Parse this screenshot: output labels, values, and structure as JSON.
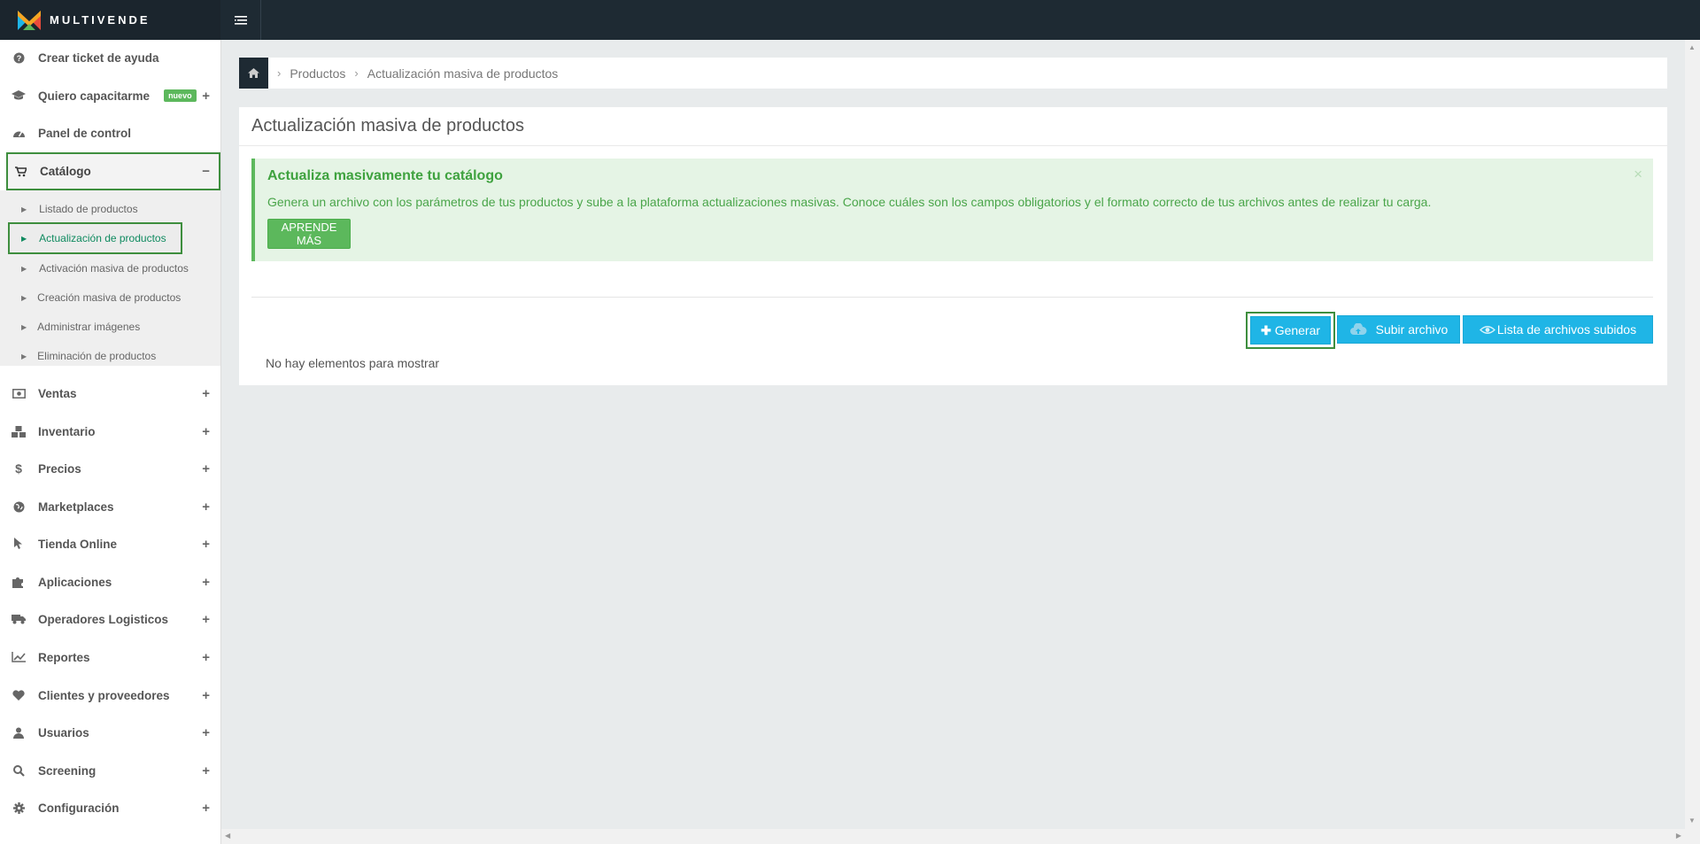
{
  "brand": {
    "name": "MULTIVENDE",
    "colors": {
      "topbar": "#1e2a33",
      "accent": "#5cb85c",
      "primary_button": "#1fb5e6"
    }
  },
  "sidebar": {
    "items": [
      {
        "label": "Crear ticket de ayuda",
        "icon": "question-circle-icon"
      },
      {
        "label": "Quiero capacitarme",
        "icon": "graduation-cap-icon",
        "badge": "nuevo",
        "expand": "+"
      },
      {
        "label": "Panel de control",
        "icon": "dashboard-icon"
      },
      {
        "label": "Catálogo",
        "icon": "shopping-cart-icon",
        "expand": "−"
      },
      {
        "label": "Ventas",
        "icon": "money-icon",
        "expand": "+"
      },
      {
        "label": "Inventario",
        "icon": "cubes-icon",
        "expand": "+"
      },
      {
        "label": "Precios",
        "icon": "dollar-icon",
        "expand": "+"
      },
      {
        "label": "Marketplaces",
        "icon": "globe-icon",
        "expand": "+"
      },
      {
        "label": "Tienda Online",
        "icon": "pointer-icon",
        "expand": "+"
      },
      {
        "label": "Aplicaciones",
        "icon": "puzzle-icon",
        "expand": "+"
      },
      {
        "label": "Operadores Logisticos",
        "icon": "truck-icon",
        "expand": "+"
      },
      {
        "label": "Reportes",
        "icon": "line-chart-icon",
        "expand": "+"
      },
      {
        "label": "Clientes y proveedores",
        "icon": "heart-icon",
        "expand": "+"
      },
      {
        "label": "Usuarios",
        "icon": "user-icon",
        "expand": "+"
      },
      {
        "label": "Screening",
        "icon": "search-icon",
        "expand": "+"
      },
      {
        "label": "Configuración",
        "icon": "gear-icon",
        "expand": "+"
      }
    ],
    "catalog_submenu": [
      "Listado de productos",
      "Actualización de productos",
      "Activación masiva de productos",
      "Creación masiva de productos",
      "Administrar imágenes",
      "Eliminación de productos"
    ]
  },
  "breadcrumb": {
    "items": [
      "Productos",
      "Actualización masiva de productos"
    ]
  },
  "main": {
    "title": "Actualización masiva de productos",
    "alert": {
      "title": "Actualiza masivamente tu catálogo",
      "text": "Genera un archivo con los parámetros de tus productos y sube a la plataforma actualizaciones masivas. Conoce cuáles son los campos obligatorios y el formato correcto de tus archivos antes de realizar tu carga.",
      "button": "APRENDE MÁS",
      "close": "×"
    },
    "buttons": {
      "generar": "Generar",
      "subir": "Subir archivo",
      "lista": "Lista de archivos subidos"
    },
    "empty": "No hay elementos para mostrar"
  }
}
